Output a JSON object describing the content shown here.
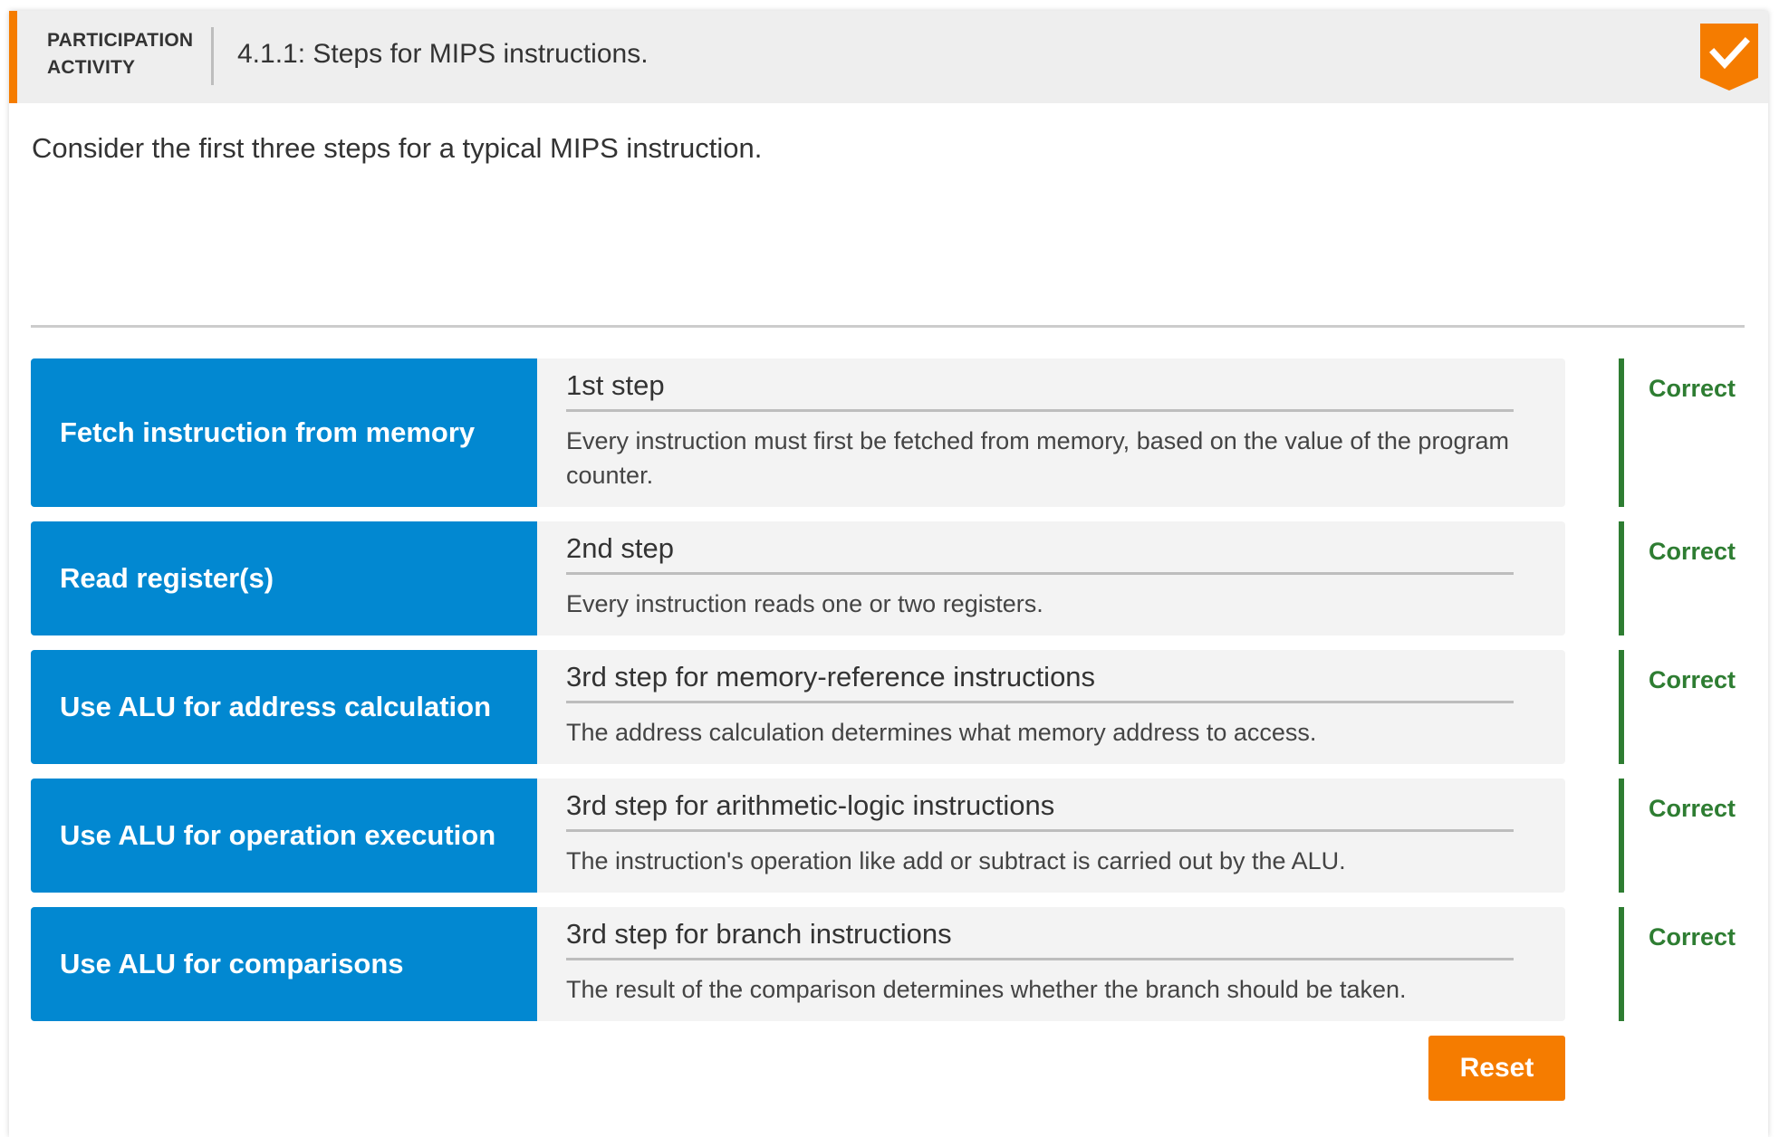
{
  "header": {
    "label_line1": "PARTICIPATION",
    "label_line2": "ACTIVITY",
    "title": "4.1.1: Steps for MIPS instructions.",
    "completion_icon": "checkmark-badge-icon",
    "accent_color": "#f57c00"
  },
  "intro": "Consider the first three steps for a typical MIPS instruction.",
  "rows": [
    {
      "term": "Fetch instruction from memory",
      "step": "1st step",
      "explanation": "Every instruction must first be fetched from memory, based on the value of the program counter.",
      "result": "Correct"
    },
    {
      "term": "Read register(s)",
      "step": "2nd step",
      "explanation": "Every instruction reads one or two registers.",
      "result": "Correct"
    },
    {
      "term": "Use ALU for address calculation",
      "step": "3rd step for memory-reference instructions",
      "explanation": "The address calculation determines what memory address to access.",
      "result": "Correct"
    },
    {
      "term": "Use ALU for operation execution",
      "step": "3rd step for arithmetic-logic instructions",
      "explanation": "The instruction's operation like add or subtract is carried out by the ALU.",
      "result": "Correct"
    },
    {
      "term": "Use ALU for comparisons",
      "step": "3rd step for branch instructions",
      "explanation": "The result of the comparison determines whether the branch should be taken.",
      "result": "Correct"
    }
  ],
  "reset_label": "Reset",
  "colors": {
    "term_background": "#0288d1",
    "correct": "#2e7d32",
    "reset": "#f57c00"
  }
}
